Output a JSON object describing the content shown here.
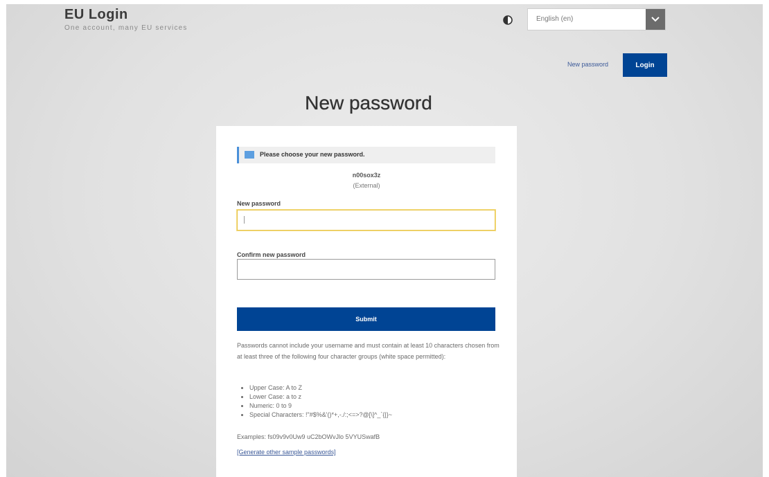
{
  "header": {
    "brand_title": "EU Login",
    "brand_subtitle": "One account, many EU services",
    "contrast_icon": "contrast-half-circle-icon",
    "language": {
      "selected": "English (en)",
      "arrow_icon": "chevron-down-icon"
    },
    "new_password_link": "New password",
    "login_button": "Login"
  },
  "main": {
    "title": "New password",
    "info": {
      "icon": "info-icon",
      "message": "Please choose your new password."
    },
    "user": {
      "username": "n00sox3z",
      "type": "(External)"
    },
    "fields": {
      "new_password_label": "New password",
      "new_password_value": "",
      "confirm_password_label": "Confirm new password",
      "confirm_password_value": ""
    },
    "submit_button": "Submit",
    "rules": {
      "intro": "Passwords cannot include your username and must contain at least 10 characters chosen from at least three of the following four character groups (white space permitted):",
      "items": [
        "Upper Case: A to Z",
        "Lower Case: a to z",
        "Numeric: 0 to 9",
        "Special Characters: !\"#$%&'()*+,-./:;<=>?@[\\]^_`{|}~"
      ],
      "examples": "Examples: fs09v9v0Uw9 uC2bOWvJlo 5VYUSwafB",
      "generate_link": "[Generate other sample passwords]"
    }
  },
  "colors": {
    "primary": "#004494",
    "info_accent": "#4a90d9",
    "focus_border": "#e8c548"
  }
}
